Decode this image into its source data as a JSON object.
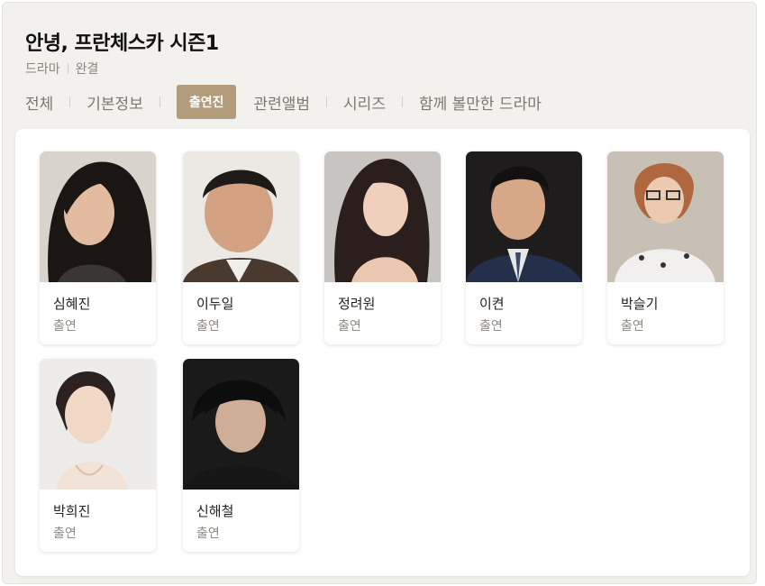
{
  "title": "안녕, 프란체스카 시즌1",
  "meta": {
    "genre": "드라마",
    "status": "완결"
  },
  "tabs": [
    {
      "label": "전체"
    },
    {
      "label": "기본정보"
    },
    {
      "label": "출연진",
      "active": true
    },
    {
      "label": "관련앨범"
    },
    {
      "label": "시리즈"
    },
    {
      "label": "함께 볼만한 드라마"
    }
  ],
  "cast": [
    {
      "name": "심혜진",
      "role": "출연"
    },
    {
      "name": "이두일",
      "role": "출연"
    },
    {
      "name": "정려원",
      "role": "출연"
    },
    {
      "name": "이켠",
      "role": "출연"
    },
    {
      "name": "박슬기",
      "role": "출연"
    },
    {
      "name": "박희진",
      "role": "출연"
    },
    {
      "name": "신해철",
      "role": "출연"
    }
  ],
  "colors": {
    "accent": "#b39c7c",
    "panel_bg": "#f3f1ed",
    "muted_text": "#8f8a82"
  }
}
